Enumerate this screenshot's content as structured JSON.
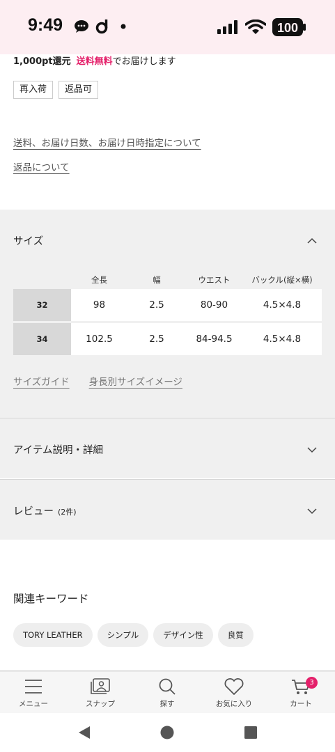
{
  "status_bar": {
    "time": "9:49",
    "battery": "100"
  },
  "shipping": {
    "points": "1,000pt還元",
    "free_shipping": "送料無料",
    "delivery_suffix": "でお届けします"
  },
  "tags": [
    "再入荷",
    "返品可"
  ],
  "links": {
    "shipping_info": "送料、お届け日数、お届け日時指定について",
    "returns": "返品について"
  },
  "size_section": {
    "title": "サイズ",
    "columns": [
      "全長",
      "幅",
      "ウエスト",
      "バックル(縦×横)"
    ],
    "rows": [
      {
        "label": "32",
        "values": [
          "98",
          "2.5",
          "80-90",
          "4.5×4.8"
        ]
      },
      {
        "label": "34",
        "values": [
          "102.5",
          "2.5",
          "84-94.5",
          "4.5×4.8"
        ]
      }
    ],
    "size_guide": "サイズガイド",
    "height_image": "身長別サイズイメージ"
  },
  "item_details": {
    "title": "アイテム説明・詳細"
  },
  "reviews": {
    "title": "レビュー",
    "count": "(2件)"
  },
  "keywords": {
    "title": "関連キーワード",
    "items": [
      "TORY LEATHER",
      "シンプル",
      "デザイン性",
      "良質"
    ]
  },
  "bottom_nav": {
    "menu": "メニュー",
    "snap": "スナップ",
    "search": "探す",
    "favorites": "お気に入り",
    "cart": "カート",
    "cart_count": "3"
  },
  "colors": {
    "accent": "#e4206a",
    "status_bg": "#fdeef2",
    "section_bg": "#f0f0f0"
  }
}
